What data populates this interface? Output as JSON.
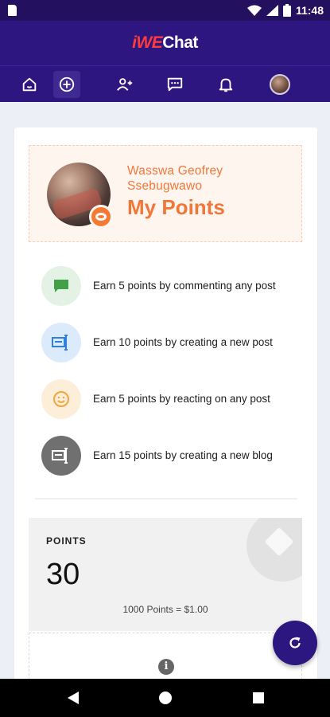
{
  "status_bar": {
    "time": "11:48"
  },
  "app": {
    "brand_part1": "iWE",
    "brand_part2": "Chat"
  },
  "nav": {
    "items": [
      {
        "name": "home-icon"
      },
      {
        "name": "add-circle-icon"
      },
      {
        "name": "add-friend-icon"
      },
      {
        "name": "chat-icon"
      },
      {
        "name": "notification-bell-icon"
      },
      {
        "name": "profile-avatar"
      }
    ]
  },
  "profile": {
    "user_name": "Wasswa Geofrey Ssebugwawo",
    "page_title": "My Points"
  },
  "earn_items": [
    {
      "text": "Earn 5 points by commenting any post",
      "icon": "comment-icon",
      "color": "#43a047",
      "bg": "#e3f2e4"
    },
    {
      "text": "Earn 10 points by creating a new post",
      "icon": "post-icon",
      "color": "#2f80e0",
      "bg": "#dcebfb"
    },
    {
      "text": "Earn 5 points by reacting on any post",
      "icon": "smile-icon",
      "color": "#f2a53a",
      "bg": "#fdeed9"
    },
    {
      "text": "Earn 15 points by creating a new blog",
      "icon": "blog-icon",
      "color": "#ffffff",
      "bg": "#707070"
    }
  ],
  "points": {
    "label": "POINTS",
    "value": "30",
    "rate": "1000 Points = $1.00"
  },
  "colors": {
    "primary": "#2e1680",
    "accent": "#f0773a"
  }
}
